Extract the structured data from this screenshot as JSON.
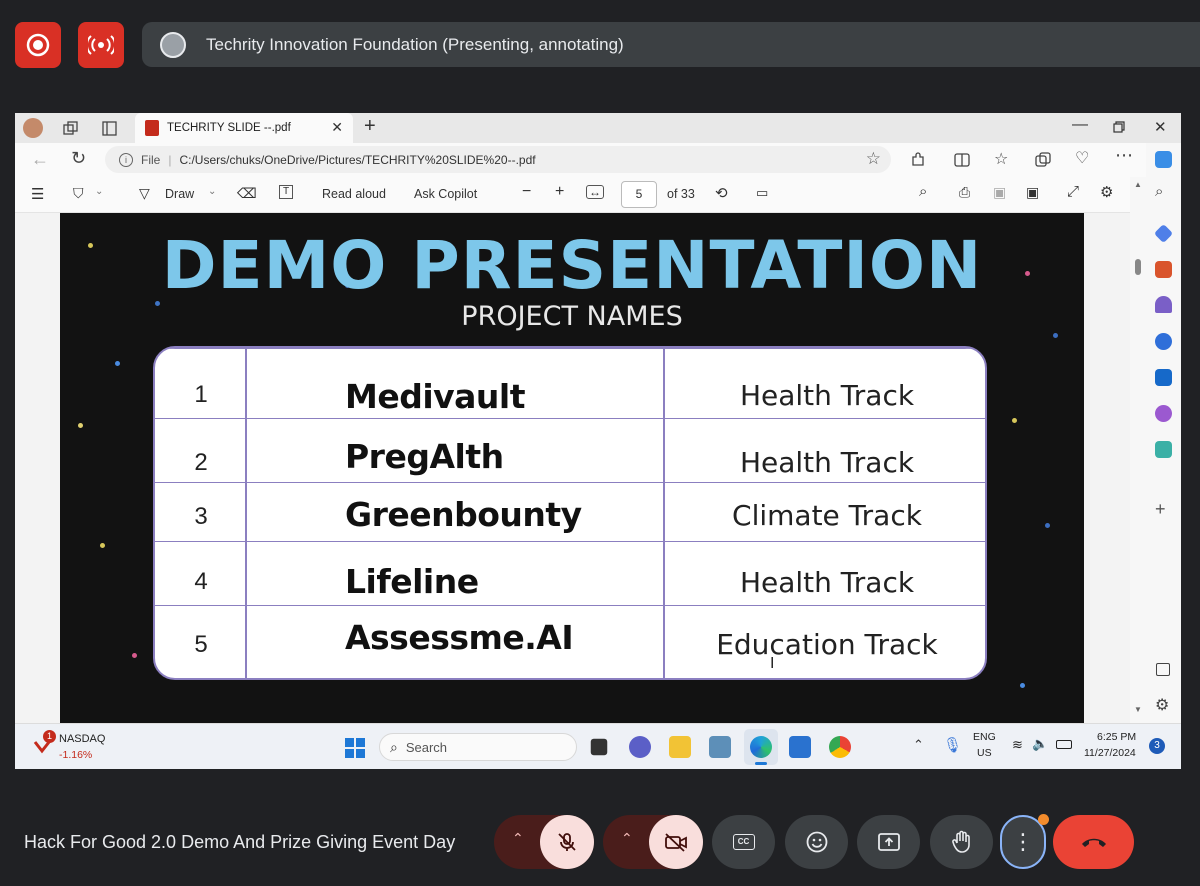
{
  "meet": {
    "presenting_label": "Techrity Innovation Foundation (Presenting, annotating)",
    "meeting_title": "Hack For Good 2.0 Demo And Prize Giving Event Day"
  },
  "browser": {
    "tab_title": "TECHRITY SLIDE --.pdf",
    "url_prefix": "File",
    "url": "C:/Users/chuks/OneDrive/Pictures/TECHRITY%20SLIDE%20--.pdf"
  },
  "pdf_toolbar": {
    "draw_label": "Draw",
    "read_aloud_label": "Read aloud",
    "ask_copilot_label": "Ask Copilot",
    "page_number": "5",
    "page_total": "of 33"
  },
  "slide": {
    "title": "DEMO PRESENTATION",
    "subtitle": "PROJECT NAMES",
    "rows": [
      {
        "num": "1",
        "name": "Medivault",
        "track": "Health Track"
      },
      {
        "num": "2",
        "name": "PregAlth",
        "track": "Health Track"
      },
      {
        "num": "3",
        "name": "Greenbounty",
        "track": "Climate Track"
      },
      {
        "num": "4",
        "name": "Lifeline",
        "track": "Health Track"
      },
      {
        "num": "5",
        "name": "Assessme.AI",
        "track": "Education Track"
      }
    ]
  },
  "taskbar": {
    "stock_name": "NASDAQ",
    "stock_change": "-1.16%",
    "stock_badge": "1",
    "search_placeholder": "Search",
    "lang": "ENG",
    "region": "US",
    "time": "6:25 PM",
    "date": "11/27/2024",
    "notification_count": "3"
  },
  "colors": {
    "record_red": "#d93025",
    "slide_title_blue": "#7dc7ea",
    "table_border": "#8b7fc0",
    "end_call_red": "#ea4335"
  }
}
